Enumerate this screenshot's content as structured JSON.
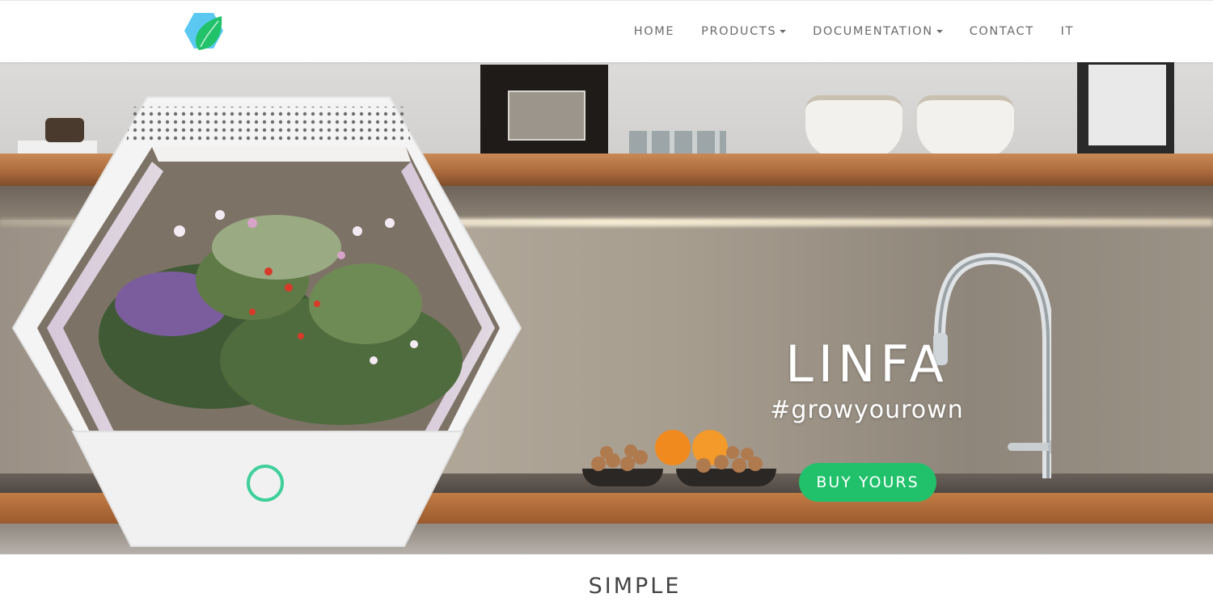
{
  "header": {
    "logo_icon": "hexagon-leaf-logo-icon",
    "nav": [
      {
        "label": "HOME",
        "dropdown": false
      },
      {
        "label": "PRODUCTS",
        "dropdown": true
      },
      {
        "label": "DOCUMENTATION",
        "dropdown": true
      },
      {
        "label": "CONTACT",
        "dropdown": false
      },
      {
        "label": "IT",
        "dropdown": false
      }
    ]
  },
  "hero": {
    "title": "LINFA",
    "tagline": "#growyourown",
    "cta_label": "BUY YOURS",
    "cta_color": "#21c16b",
    "image": "linfa-planter-kitchen-photo"
  },
  "section": {
    "title": "SIMPLE"
  },
  "colors": {
    "logo_blue": "#5bc8f2",
    "logo_green": "#22c26a",
    "nav_text": "#6b6b6b"
  }
}
